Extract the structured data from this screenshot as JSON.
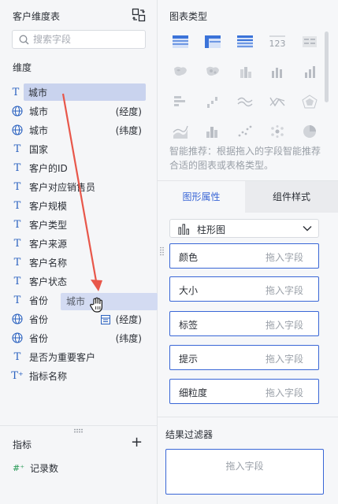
{
  "left": {
    "title": "客户维度表",
    "search_placeholder": "搜索字段",
    "dimension_heading": "维度",
    "dragging_field": "城市",
    "fields": [
      {
        "type": "T",
        "name": "城市",
        "suffix": "(经度)",
        "icon": "globe-icon"
      },
      {
        "type": "G",
        "name": "城市",
        "suffix": "(纬度)",
        "icon": "globe-icon"
      },
      {
        "type": "T",
        "name": "国家",
        "suffix": "",
        "icon": "text-type-icon"
      },
      {
        "type": "T",
        "name": "客户的ID",
        "suffix": "",
        "icon": "text-type-icon"
      },
      {
        "type": "T",
        "name": "客户对应销售员",
        "suffix": "",
        "icon": "text-type-icon"
      },
      {
        "type": "T",
        "name": "客户规模",
        "suffix": "",
        "icon": "text-type-icon"
      },
      {
        "type": "T",
        "name": "客户类型",
        "suffix": "",
        "icon": "text-type-icon"
      },
      {
        "type": "T",
        "name": "客户来源",
        "suffix": "",
        "icon": "text-type-icon"
      },
      {
        "type": "T",
        "name": "客户名称",
        "suffix": "",
        "icon": "text-type-icon"
      },
      {
        "type": "T",
        "name": "客户状态",
        "suffix": "",
        "icon": "text-type-icon"
      },
      {
        "type": "T",
        "name": "省份",
        "suffix": "",
        "icon": "text-type-icon"
      },
      {
        "type": "G",
        "name": "省份",
        "suffix": "(经度)",
        "icon": "globe-icon"
      },
      {
        "type": "G",
        "name": "省份",
        "suffix": "(纬度)",
        "icon": "globe-icon"
      },
      {
        "type": "T",
        "name": "是否为重要客户",
        "suffix": "",
        "icon": "text-type-icon"
      },
      {
        "type": "T+",
        "name": "指标名称",
        "suffix": "",
        "icon": "text-calc-icon"
      }
    ],
    "ghost_label": "城市",
    "metric_heading": "指标",
    "metric_add": "+",
    "metric_icon_glyph": "#⁺",
    "metric_name": "记录数",
    "text_glyph": "T",
    "text_calc_glyph": "T⁺"
  },
  "right": {
    "chart_type_title": "图表类型",
    "smart_recommend": "智能推荐：根据拖入的字段智能推荐合适的图表或表格类型。",
    "tabs": [
      "图形属性",
      "组件样式"
    ],
    "chart_select_label": "柱形图",
    "drop_fields": [
      {
        "label": "颜色",
        "hint": "拖入字段"
      },
      {
        "label": "大小",
        "hint": "拖入字段"
      },
      {
        "label": "标签",
        "hint": "拖入字段"
      },
      {
        "label": "提示",
        "hint": "拖入字段"
      },
      {
        "label": "细粒度",
        "hint": "拖入字段"
      }
    ],
    "result_filter_title": "结果过滤器",
    "result_filter_hint": "拖入字段",
    "number_thumb_text": "123"
  },
  "colors": {
    "accent": "#3966d6",
    "drag_highlight": "#c9d3ee",
    "arrow": "#e8574a",
    "field_icon": "#2b62c0",
    "metric_icon": "#2d9c5a"
  }
}
